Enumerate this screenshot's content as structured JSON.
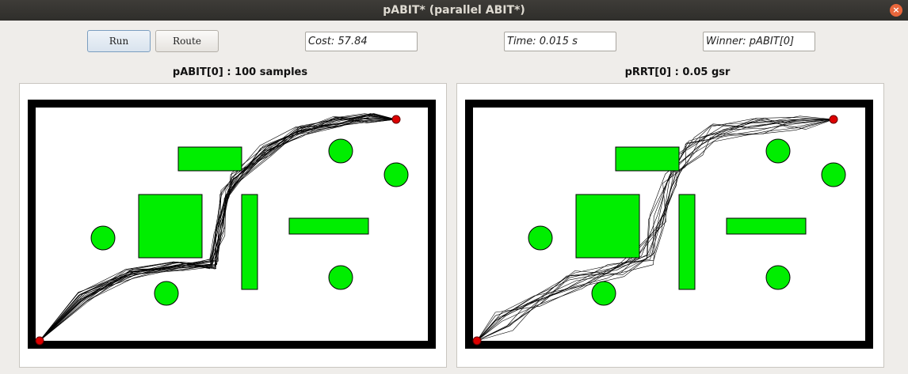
{
  "window": {
    "title": "pABIT* (parallel ABIT*)",
    "close_glyph": "×"
  },
  "toolbar": {
    "run_label": "Run",
    "route_label": "Route",
    "cost_text": "Cost: 57.84",
    "time_text": "Time: 0.015 s",
    "winner_text": "Winner: pABIT[0]"
  },
  "panels": [
    {
      "title": "pABIT[0] : 100 samples"
    },
    {
      "title": "pRRT[0] : 0.05 gsr"
    }
  ],
  "colors": {
    "obstacle": "#00ee00",
    "wall": "#000000",
    "endpoint": "#dd0000"
  }
}
